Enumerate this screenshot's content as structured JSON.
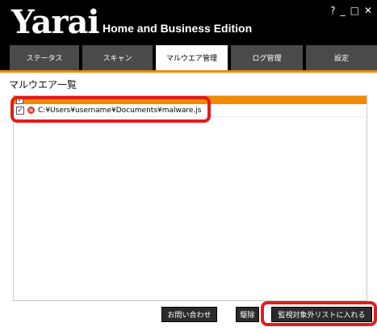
{
  "app": {
    "logo": "Yarai",
    "edition": "Home and Business Edition",
    "window_controls": [
      "?",
      "_",
      "□",
      "✕"
    ]
  },
  "tabs": [
    {
      "label": "ステータス",
      "active": false
    },
    {
      "label": "スキャン",
      "active": false
    },
    {
      "label": "マルウエア管理",
      "active": true
    },
    {
      "label": "ログ管理",
      "active": false
    },
    {
      "label": "設定",
      "active": false
    }
  ],
  "main": {
    "section_title": "マルウエア一覧",
    "list": {
      "header_checked": true,
      "rows": [
        {
          "checked": true,
          "icon": "malware-icon",
          "path": "C:¥Users¥username¥Documents¥malware.js"
        }
      ]
    }
  },
  "buttons": {
    "contact": "お問い合わせ",
    "remove": "駆除",
    "exclude": "監視対象外リストに入れる"
  },
  "colors": {
    "accent": "#f08a00",
    "annotation": "#e51b1b",
    "header_bg": "#000000",
    "tab_bg": "#4a4a4a"
  }
}
